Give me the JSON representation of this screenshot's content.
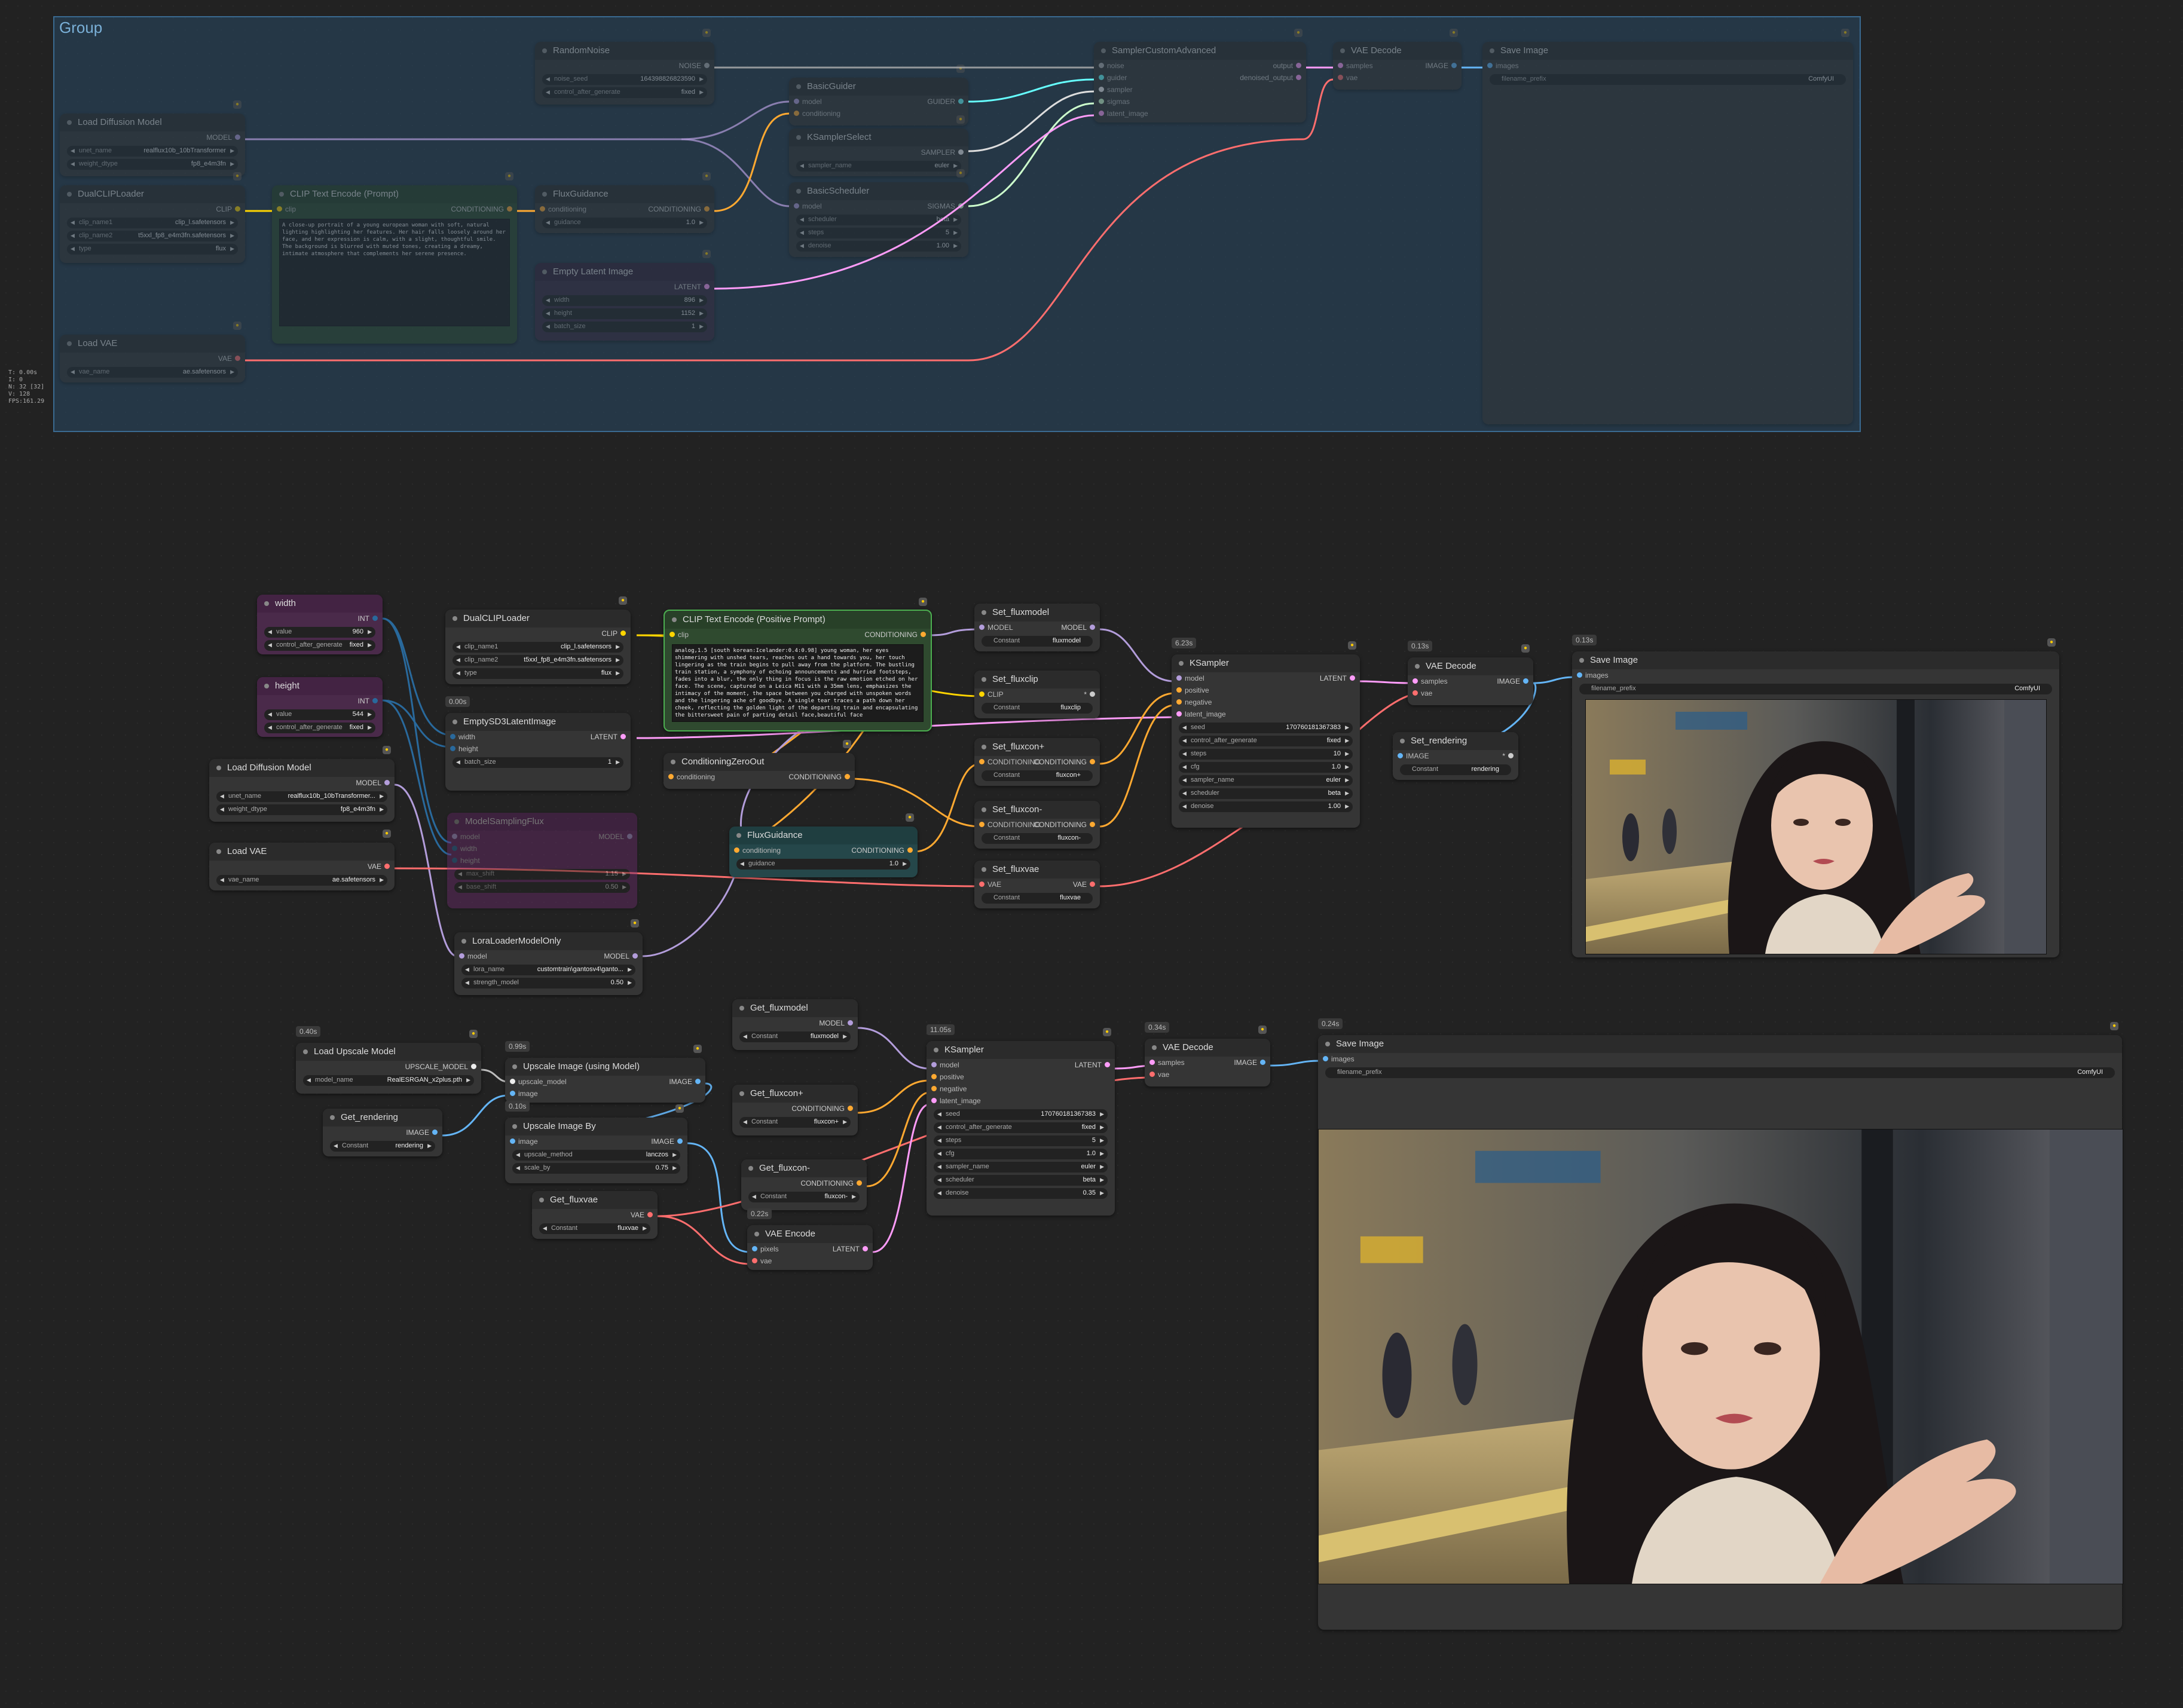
{
  "stats": [
    "T: 0.00s",
    "I: 0",
    "N: 32 [32]",
    "V: 128",
    "FPS:161.29"
  ],
  "group": {
    "title": "Group"
  },
  "top_nodes": {
    "random_noise": {
      "title": "RandomNoise",
      "out": "NOISE",
      "w1l": "noise_seed",
      "w1v": "164398826823590",
      "w2l": "control_after_generate",
      "w2v": "fixed"
    },
    "load_diffusion": {
      "title": "Load Diffusion Model",
      "out": "MODEL",
      "w1l": "unet_name",
      "w1v": "realflux10b_10bTransformer",
      "w2l": "weight_dtype",
      "w2v": "fp8_e4m3fn"
    },
    "dual_clip": {
      "title": "DualCLIPLoader",
      "out": "CLIP",
      "w1l": "clip_name1",
      "w1v": "clip_l.safetensors",
      "w2l": "clip_name2",
      "w2v": "t5xxl_fp8_e4m3fn.safetensors",
      "w3l": "type",
      "w3v": "flux"
    },
    "clip_text": {
      "title": "CLIP Text Encode (Prompt)",
      "in": "clip",
      "out": "CONDITIONING",
      "text": "A close-up portrait of a young european woman with soft, natural lighting highlighting her features. Her hair falls loosely around her face, and her expression is calm, with a slight, thoughtful smile. The background is blurred with muted tones, creating a dreamy, intimate atmosphere that complements her serene presence."
    },
    "flux_guidance": {
      "title": "FluxGuidance",
      "in": "conditioning",
      "out": "CONDITIONING",
      "w1l": "guidance",
      "w1v": "1.0"
    },
    "empty_latent": {
      "title": "Empty Latent Image",
      "out": "LATENT",
      "w1l": "width",
      "w1v": "896",
      "w2l": "height",
      "w2v": "1152",
      "w3l": "batch_size",
      "w3v": "1"
    },
    "load_vae": {
      "title": "Load VAE",
      "out": "VAE",
      "w1l": "vae_name",
      "w1v": "ae.safetensors"
    },
    "basic_guider": {
      "title": "BasicGuider",
      "in1": "model",
      "in2": "conditioning",
      "out": "GUIDER"
    },
    "ksampler_select": {
      "title": "KSamplerSelect",
      "out": "SAMPLER",
      "w1l": "sampler_name",
      "w1v": "euler"
    },
    "basic_scheduler": {
      "title": "BasicScheduler",
      "in": "model",
      "out": "SIGMAS",
      "w1l": "scheduler",
      "w1v": "beta",
      "w2l": "steps",
      "w2v": "5",
      "w3l": "denoise",
      "w3v": "1.00"
    },
    "sampler_custom": {
      "title": "SamplerCustomAdvanced",
      "ins": [
        "noise",
        "guider",
        "sampler",
        "sigmas",
        "latent_image"
      ],
      "out1": "output",
      "out2": "denoised_output"
    },
    "vae_decode": {
      "title": "VAE Decode",
      "in1": "samples",
      "in2": "vae",
      "out": "IMAGE"
    },
    "save_image": {
      "title": "Save Image",
      "in": "images",
      "w1l": "filename_prefix",
      "w1v": "ComfyUI"
    }
  },
  "nodes": {
    "width": {
      "title": "width",
      "out": "INT",
      "w1l": "value",
      "w1v": "960",
      "w2l": "control_after_generate",
      "w2v": "fixed"
    },
    "height": {
      "title": "height",
      "out": "INT",
      "w1l": "value",
      "w1v": "544",
      "w2l": "control_after_generate",
      "w2v": "fixed"
    },
    "dual_clip": {
      "title": "DualCLIPLoader",
      "out": "CLIP",
      "w1l": "clip_name1",
      "w1v": "clip_l.safetensors",
      "w2l": "clip_name2",
      "w2v": "t5xxl_fp8_e4m3fn.safetensors",
      "w3l": "type",
      "w3v": "flux"
    },
    "empty_sd3": {
      "badge": "0.00s",
      "title": "EmptySD3LatentImage",
      "in1": "width",
      "in2": "height",
      "out": "LATENT",
      "w1l": "batch_size",
      "w1v": "1"
    },
    "load_diffusion": {
      "title": "Load Diffusion Model",
      "out": "MODEL",
      "w1l": "unet_name",
      "w1v": "realflux10b_10bTransformer...",
      "w2l": "weight_dtype",
      "w2v": "fp8_e4m3fn"
    },
    "load_vae": {
      "title": "Load VAE",
      "out": "VAE",
      "w1l": "vae_name",
      "w1v": "ae.safetensors"
    },
    "model_sampling": {
      "title": "ModelSamplingFlux",
      "in1": "model",
      "in2": "width",
      "in3": "height",
      "out": "MODEL",
      "w1l": "max_shift",
      "w1v": "1.15",
      "w2l": "base_shift",
      "w2v": "0.50"
    },
    "lora": {
      "title": "LoraLoaderModelOnly",
      "in": "model",
      "out": "MODEL",
      "w1l": "lora_name",
      "w1v": "customtrain\\gantosv4\\ganto...",
      "w2l": "strength_model",
      "w2v": "0.50"
    },
    "clip_pos": {
      "title": "CLIP Text Encode (Positive Prompt)",
      "in": "clip",
      "out": "CONDITIONING",
      "text": "analog,1.5 [south korean:Icelander:0.4:0.98] young woman, her eyes shimmering with unshed tears, reaches out a hand towards you, her touch lingering as the train begins to pull away from the platform. The bustling train station, a symphony of echoing announcements and hurried footsteps, fades into a blur, the only thing in focus is the raw emotion etched on her face. The scene, captured on a Leica M11 with a 35mm lens, emphasizes the intimacy of the moment, the space between you charged with unspoken words and the lingering ache of goodbye. A single tear traces a path down her cheek, reflecting the golden light of the departing train and encapsulating the bittersweet pain of parting detail face,beautiful face"
    },
    "cond_zero": {
      "title": "ConditioningZeroOut",
      "in": "conditioning",
      "out": "CONDITIONING"
    },
    "flux_guidance": {
      "title": "FluxGuidance",
      "in": "conditioning",
      "out": "CONDITIONING",
      "w1l": "guidance",
      "w1v": "1.0"
    },
    "set_fluxmodel": {
      "title": "Set_fluxmodel",
      "in": "MODEL",
      "out": "MODEL",
      "w1l": "Constant",
      "w1v": "fluxmodel"
    },
    "set_fluxclip": {
      "title": "Set_fluxclip",
      "in": "CLIP",
      "out": "*",
      "w1l": "Constant",
      "w1v": "fluxclip"
    },
    "set_fluxcon_pos": {
      "title": "Set_fluxcon+",
      "in": "CONDITIONING",
      "out": "CONDITIONING",
      "w1l": "Constant",
      "w1v": "fluxcon+"
    },
    "set_fluxcon_neg": {
      "title": "Set_fluxcon-",
      "in": "CONDITIONING",
      "out": "CONDITIONING",
      "w1l": "Constant",
      "w1v": "fluxcon-"
    },
    "set_fluxvae": {
      "title": "Set_fluxvae",
      "in": "VAE",
      "out": "VAE",
      "w1l": "Constant",
      "w1v": "fluxvae"
    },
    "ksampler1": {
      "badge": "6.23s",
      "title": "KSampler",
      "ins": [
        "model",
        "positive",
        "negative",
        "latent_image"
      ],
      "out": "LATENT",
      "widgets": [
        [
          "seed",
          "170760181367383"
        ],
        [
          "control_after_generate",
          "fixed"
        ],
        [
          "steps",
          "10"
        ],
        [
          "cfg",
          "1.0"
        ],
        [
          "sampler_name",
          "euler"
        ],
        [
          "scheduler",
          "beta"
        ],
        [
          "denoise",
          "1.00"
        ]
      ]
    },
    "vae_decode1": {
      "badge": "0.13s",
      "title": "VAE Decode",
      "in1": "samples",
      "in2": "vae",
      "out": "IMAGE"
    },
    "set_rendering": {
      "title": "Set_rendering",
      "in": "IMAGE",
      "out": "*",
      "w1l": "Constant",
      "w1v": "rendering"
    },
    "save1": {
      "badge": "0.13s",
      "title": "Save Image",
      "in": "images",
      "w1l": "filename_prefix",
      "w1v": "ComfyUI"
    },
    "load_upscale": {
      "badge": "0.40s",
      "title": "Load Upscale Model",
      "out": "UPSCALE_MODEL",
      "w1l": "model_name",
      "w1v": "RealESRGAN_x2plus.pth"
    },
    "get_rendering": {
      "title": "Get_rendering",
      "out": "IMAGE",
      "w1l": "Constant",
      "w1v": "rendering"
    },
    "upscale_model": {
      "badge": "0.99s",
      "title": "Upscale Image (using Model)",
      "in1": "upscale_model",
      "in2": "image",
      "out": "IMAGE"
    },
    "upscale_by": {
      "badge": "0.10s",
      "title": "Upscale Image By",
      "in": "image",
      "out": "IMAGE",
      "w1l": "upscale_method",
      "w1v": "lanczos",
      "w2l": "scale_by",
      "w2v": "0.75"
    },
    "get_fluxvae": {
      "title": "Get_fluxvae",
      "out": "VAE",
      "w1l": "Constant",
      "w1v": "fluxvae"
    },
    "get_fluxmodel": {
      "title": "Get_fluxmodel",
      "out": "MODEL",
      "w1l": "Constant",
      "w1v": "fluxmodel"
    },
    "get_fluxcon_pos": {
      "title": "Get_fluxcon+",
      "out": "CONDITIONING",
      "w1l": "Constant",
      "w1v": "fluxcon+"
    },
    "get_fluxcon_neg": {
      "title": "Get_fluxcon-",
      "out": "CONDITIONING",
      "w1l": "Constant",
      "w1v": "fluxcon-"
    },
    "vae_encode": {
      "badge": "0.22s",
      "title": "VAE Encode",
      "in1": "pixels",
      "in2": "vae",
      "out": "LATENT"
    },
    "ksampler2": {
      "badge": "11.05s",
      "title": "KSampler",
      "ins": [
        "model",
        "positive",
        "negative",
        "latent_image"
      ],
      "out": "LATENT",
      "widgets": [
        [
          "seed",
          "170760181367383"
        ],
        [
          "control_after_generate",
          "fixed"
        ],
        [
          "steps",
          "5"
        ],
        [
          "cfg",
          "1.0"
        ],
        [
          "sampler_name",
          "euler"
        ],
        [
          "scheduler",
          "beta"
        ],
        [
          "denoise",
          "0.35"
        ]
      ]
    },
    "vae_decode2": {
      "badge": "0.34s",
      "title": "VAE Decode",
      "in1": "samples",
      "in2": "vae",
      "out": "IMAGE"
    },
    "save2": {
      "badge": "0.24s",
      "title": "Save Image",
      "in": "images",
      "w1l": "filename_prefix",
      "w1v": "ComfyUI"
    }
  },
  "colors": {
    "model": "#b39ddb",
    "clip": "#ffd500",
    "conditioning": "#ffa931",
    "latent": "#ff9cf9",
    "vae": "#ff6e6e",
    "image": "#64b5f6",
    "int": "#29699c",
    "sigmas": "#cdffcd",
    "guider": "#66ffff",
    "noise": "#b0b0b0"
  }
}
